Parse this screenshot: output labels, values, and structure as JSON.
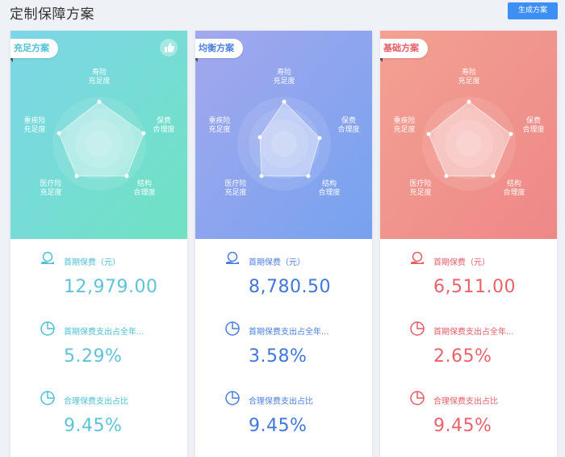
{
  "header": {
    "title": "定制保障方案",
    "generate_button": "生成方案"
  },
  "axis_labels": {
    "top": "寿险\n充足度",
    "right": "保费\n合理度",
    "bottom_right": "结构\n合理度",
    "bottom_left": "医疗险\n充足度",
    "left": "重疾险\n充足度"
  },
  "plans": [
    {
      "name": "充足方案",
      "recommended_icon": "thumbs-up-icon",
      "color_from": "#7dd8e6",
      "color_to": "#6fe0c3",
      "metrics": [
        {
          "icon": "premium-icon",
          "label": "首期保费（元）",
          "value": "12,979.00"
        },
        {
          "icon": "pie-chart-icon",
          "label": "首期保费支出占全年...",
          "value": "5.29%"
        },
        {
          "icon": "pie-chart-icon",
          "label": "合理保费支出占比",
          "value": "9.45%"
        }
      ]
    },
    {
      "name": "均衡方案",
      "color_from": "#9aa6ee",
      "color_to": "#7aa1ef",
      "metrics": [
        {
          "icon": "premium-icon",
          "label": "首期保费（元）",
          "value": "8,780.50"
        },
        {
          "icon": "pie-chart-icon",
          "label": "首期保费支出占全年...",
          "value": "3.58%"
        },
        {
          "icon": "pie-chart-icon",
          "label": "合理保费支出占比",
          "value": "9.45%"
        }
      ]
    },
    {
      "name": "基础方案",
      "color_from": "#f29a8f",
      "color_to": "#ef8a8a",
      "metrics": [
        {
          "icon": "premium-icon",
          "label": "首期保费（元）",
          "value": "6,511.00"
        },
        {
          "icon": "pie-chart-icon",
          "label": "首期保费支出占全年...",
          "value": "2.65%"
        },
        {
          "icon": "pie-chart-icon",
          "label": "合理保费支出占比",
          "value": "9.45%"
        }
      ]
    }
  ]
}
